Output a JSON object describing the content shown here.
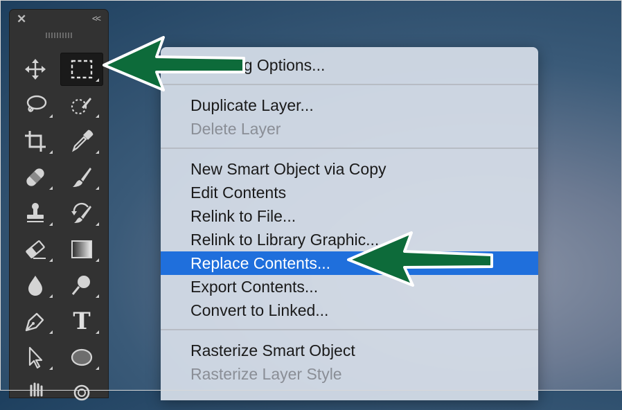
{
  "toolbar": {
    "close_glyph": "✕",
    "collapse_glyph": "<<",
    "tools": [
      {
        "name": "move-tool",
        "icon": "move-icon"
      },
      {
        "name": "rectangular-marquee-tool",
        "icon": "marquee-icon",
        "active": true
      },
      {
        "name": "lasso-tool",
        "icon": "lasso-icon"
      },
      {
        "name": "quick-selection-tool",
        "icon": "quick-selection-icon"
      },
      {
        "name": "crop-tool",
        "icon": "crop-icon"
      },
      {
        "name": "eyedropper-tool",
        "icon": "eyedropper-icon"
      },
      {
        "name": "healing-brush-tool",
        "icon": "bandage-icon"
      },
      {
        "name": "brush-tool",
        "icon": "brush-icon"
      },
      {
        "name": "clone-stamp-tool",
        "icon": "stamp-icon"
      },
      {
        "name": "history-brush-tool",
        "icon": "history-brush-icon"
      },
      {
        "name": "eraser-tool",
        "icon": "eraser-icon"
      },
      {
        "name": "gradient-tool",
        "icon": "gradient-icon"
      },
      {
        "name": "blur-tool",
        "icon": "drop-icon"
      },
      {
        "name": "dodge-tool",
        "icon": "dodge-icon"
      },
      {
        "name": "pen-tool",
        "icon": "pen-icon"
      },
      {
        "name": "type-tool",
        "icon": "type-icon",
        "glyph": "T"
      },
      {
        "name": "path-selection-tool",
        "icon": "arrow-cursor-icon"
      },
      {
        "name": "ellipse-tool",
        "icon": "ellipse-icon"
      },
      {
        "name": "hand-tool",
        "icon": "hand-icon"
      },
      {
        "name": "zoom-tool",
        "icon": "zoom-icon"
      }
    ]
  },
  "menu": {
    "items": [
      {
        "label": "Blending Options...",
        "disabled": false
      },
      {
        "label": "Duplicate Layer...",
        "disabled": false
      },
      {
        "label": "Delete Layer",
        "disabled": true
      },
      {
        "label": "New Smart Object via Copy",
        "disabled": false
      },
      {
        "label": "Edit Contents",
        "disabled": false
      },
      {
        "label": "Relink to File...",
        "disabled": false
      },
      {
        "label": "Relink to Library Graphic...",
        "disabled": false
      },
      {
        "label": "Replace Contents...",
        "disabled": false,
        "highlighted": true
      },
      {
        "label": "Export Contents...",
        "disabled": false
      },
      {
        "label": "Convert to Linked...",
        "disabled": false
      },
      {
        "label": "Rasterize Smart Object",
        "disabled": false
      },
      {
        "label": "Rasterize Layer Style",
        "disabled": true
      }
    ],
    "highlight_color": "#1f6fdc"
  },
  "annotations": {
    "arrow_color": "#0d6b3a",
    "arrow_outline": "#ffffff"
  }
}
